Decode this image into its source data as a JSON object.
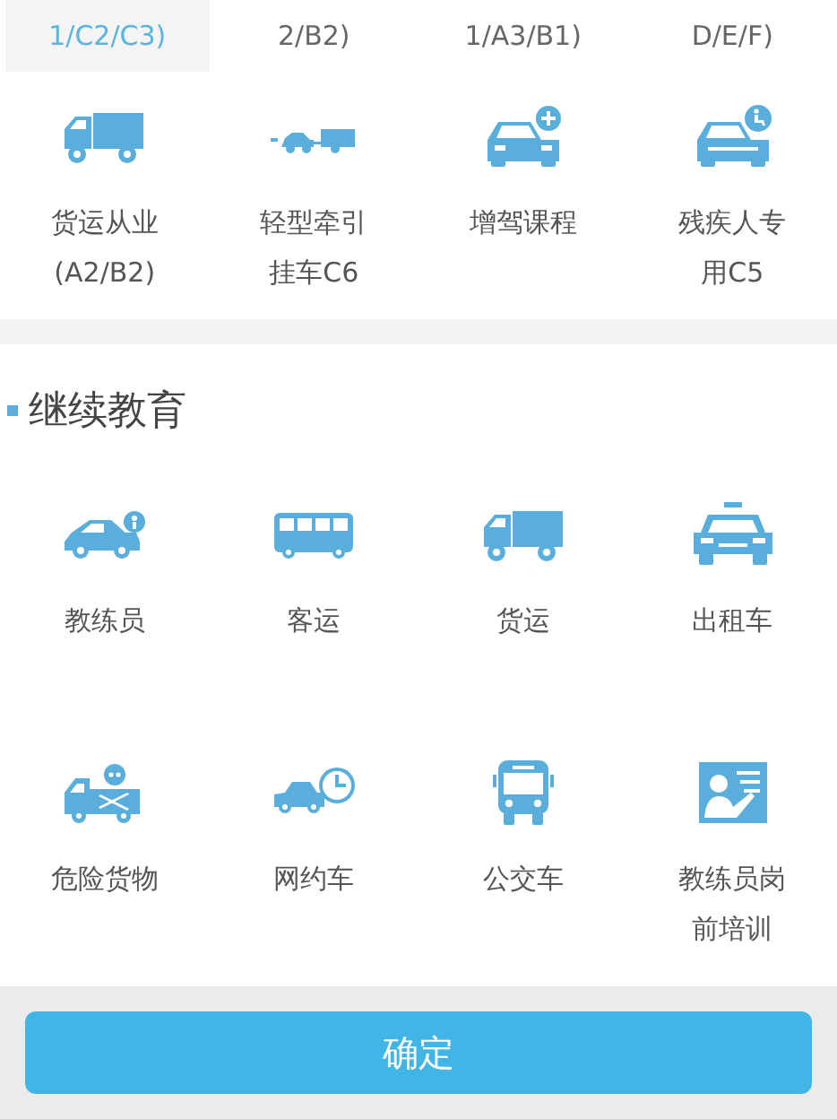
{
  "tabs": [
    {
      "label": "1/C2/C3)",
      "selected": true
    },
    {
      "label": "2/B2)",
      "selected": false
    },
    {
      "label": "1/A3/B1)",
      "selected": false
    },
    {
      "label": "D/E/F)",
      "selected": false
    }
  ],
  "sections": [
    {
      "items": [
        {
          "lines": [
            "货运从业",
            "(A2/B2)"
          ]
        },
        {
          "lines": [
            "轻型牵引",
            "挂车C6"
          ]
        },
        {
          "lines": [
            "增驾课程"
          ]
        },
        {
          "lines": [
            "残疾人专",
            "用C5"
          ]
        }
      ]
    },
    {
      "title": "继续教育",
      "items": [
        {
          "lines": [
            "教练员"
          ]
        },
        {
          "lines": [
            "客运"
          ]
        },
        {
          "lines": [
            "货运"
          ]
        },
        {
          "lines": [
            "出租车"
          ]
        },
        {
          "lines": [
            "危险货物"
          ]
        },
        {
          "lines": [
            "网约车"
          ]
        },
        {
          "lines": [
            "公交车"
          ]
        },
        {
          "lines": [
            "教练员岗",
            "前培训"
          ]
        }
      ]
    }
  ],
  "confirm_button": "确定"
}
